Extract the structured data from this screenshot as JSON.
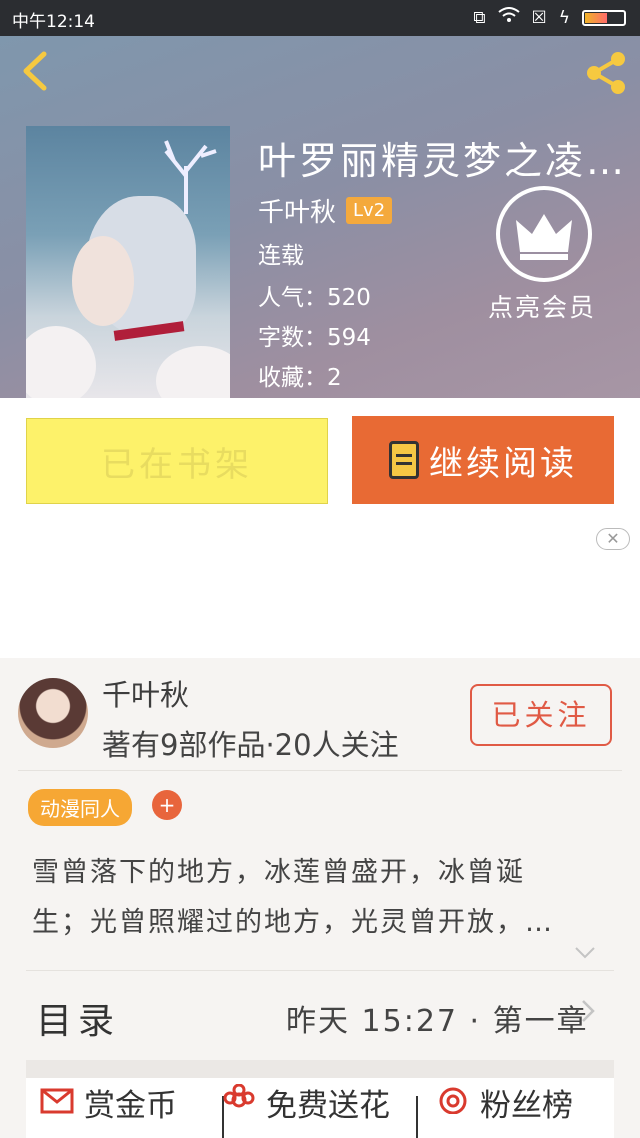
{
  "status_bar": {
    "time": "中午12:14",
    "icons": [
      "sync-icon",
      "wifi-icon",
      "sim-off-icon",
      "charging-icon",
      "battery-icon"
    ]
  },
  "header": {
    "back_icon": "chevron-left-icon",
    "share_icon": "share-icon",
    "book_title": "叶罗丽精灵梦之凌…",
    "author": "千叶秋",
    "level": "Lv2",
    "status": "连载",
    "popularity": "人气：520",
    "word_count": "字数：594",
    "favorites": "收藏：2",
    "vip_label": "点亮会员"
  },
  "buttons": {
    "on_shelf": "已在书架",
    "continue_reading": "继续阅读"
  },
  "ad": {
    "close_label": "✕"
  },
  "author_card": {
    "name": "千叶秋",
    "stats": "著有9部作品·20人关注",
    "follow_label": "已关注"
  },
  "tags": {
    "items": [
      "动漫同人"
    ],
    "add_label": "+"
  },
  "description": {
    "line1": "雪曾落下的地方，冰莲曾盛开，冰曾诞",
    "line2": "生；光曾照耀过的地方，光灵曾开放，…"
  },
  "toc": {
    "label": "目录",
    "latest": "昨天 15:27 · 第一章"
  },
  "actions": [
    {
      "label": "赏金币",
      "icon": "envelope-icon"
    },
    {
      "label": "免费送花",
      "icon": "flower-icon"
    },
    {
      "label": "粉丝榜",
      "icon": "target-icon"
    }
  ],
  "colors": {
    "accent_orange": "#e86a34",
    "shelf_yellow": "#fdf26a",
    "level_badge": "#f4a93c",
    "follow_red": "#e05a45"
  }
}
